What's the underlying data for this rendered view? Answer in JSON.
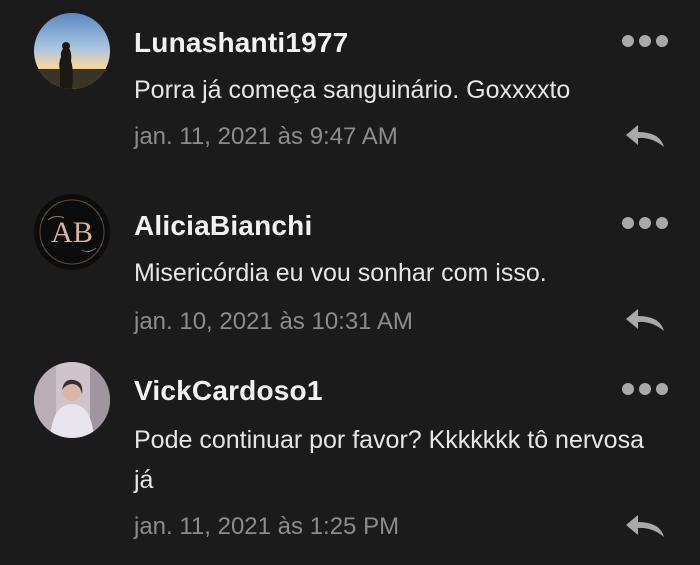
{
  "comments": [
    {
      "username": "Lunashanti1977",
      "text": "Porra já começa sanguinário. Goxxxxto",
      "timestamp": "jan. 11, 2021 às 9:47 AM",
      "avatar": "sunset-silhouette"
    },
    {
      "username": "AliciaBianchi",
      "text": "Misericórdia eu vou sonhar com isso.",
      "timestamp": "jan. 10, 2021 às 10:31 AM",
      "avatar": "AB",
      "avatar_letters": "AB"
    },
    {
      "username": "VickCardoso1",
      "text": "Pode continuar por favor? Kkkkkkk tô nervosa já",
      "timestamp": "jan. 11, 2021 às 1:25 PM",
      "avatar": "person-photo"
    }
  ],
  "icons": {
    "more": "more-options-icon",
    "reply": "reply-icon"
  },
  "colors": {
    "background": "#1b1b1c",
    "username": "#f2f2f2",
    "text": "#e6e6e6",
    "timestamp": "#8c8c8c",
    "icon": "#a9a9a9"
  }
}
